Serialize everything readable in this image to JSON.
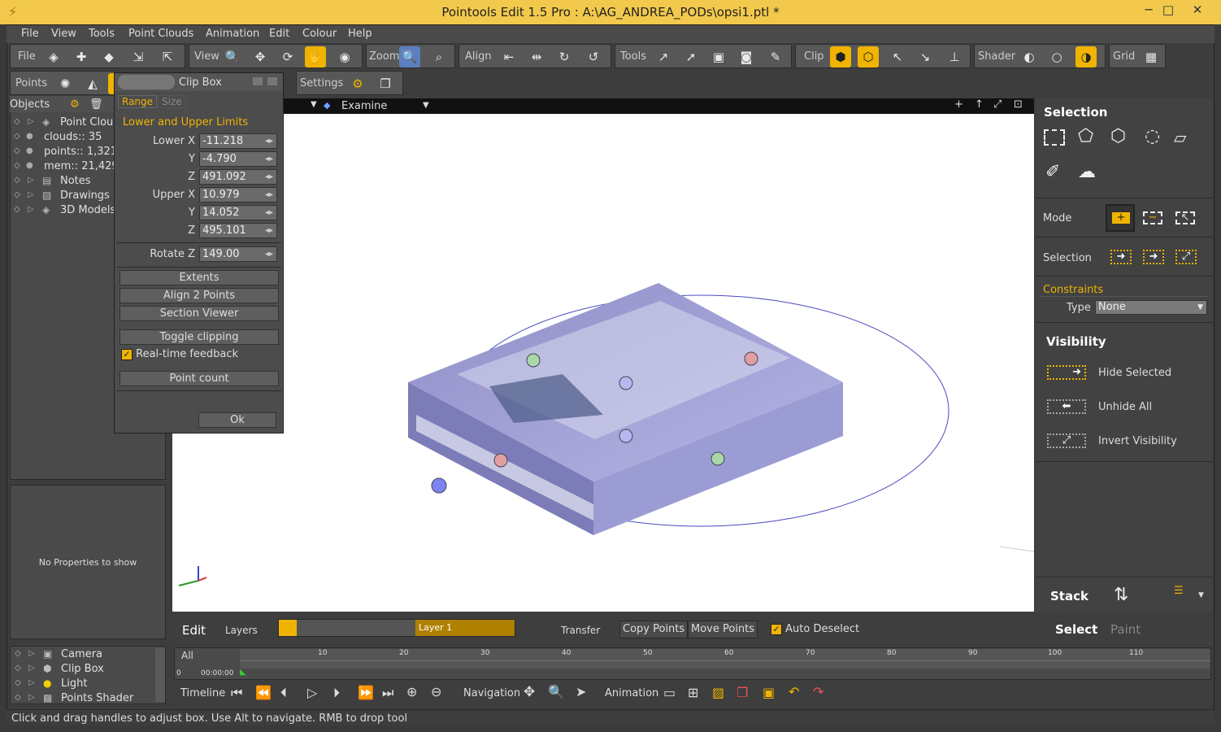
{
  "titlebar": {
    "title": "Pointools Edit 1.5 Pro  :  A:\\AG_ANDREA_PODs\\opsi1.ptl *",
    "min": "─",
    "max": "□",
    "close": "✕"
  },
  "menu": [
    "File",
    "View",
    "Tools",
    "Point Clouds",
    "Animation",
    "Edit",
    "Colour",
    "Help"
  ],
  "toolbar": {
    "file": "File",
    "view": "View",
    "zoom": "Zoom",
    "align": "Align",
    "tools": "Tools",
    "clip": "Clip",
    "shader": "Shader",
    "grid": "Grid",
    "points": "Points",
    "settings": "Settings"
  },
  "objects": {
    "header": "Objects",
    "tree": [
      {
        "label": "Point Clou"
      },
      {
        "label": "clouds:: 35"
      },
      {
        "label": "points:: 1,321"
      },
      {
        "label": "mem:: 21,429"
      },
      {
        "label": "Notes"
      },
      {
        "label": "Drawings"
      },
      {
        "label": "3D Models"
      }
    ]
  },
  "props": {
    "empty": "No Properties to show"
  },
  "layerlist": [
    {
      "label": "Camera"
    },
    {
      "label": "Clip Box"
    },
    {
      "label": "Light"
    },
    {
      "label": "Points Shader"
    }
  ],
  "clipbox": {
    "title": "Clip Box",
    "tab_range": "Range",
    "tab_size": "Size",
    "section": "Lower and Upper Limits",
    "lower_x_label": "Lower X",
    "lower_x": "-11.218",
    "lower_y_label": "Y",
    "lower_y": "-4.790",
    "lower_z_label": "Z",
    "lower_z": "491.092",
    "upper_x_label": "Upper X",
    "upper_x": "10.979",
    "upper_y_label": "Y",
    "upper_y": "14.052",
    "upper_z_label": "Z",
    "upper_z": "495.101",
    "rotate_label": "Rotate Z",
    "rotate": "149.00",
    "extents": "Extents",
    "align2": "Align 2 Points",
    "section_viewer": "Section Viewer",
    "toggle": "Toggle clipping",
    "realtime": "Real-time feedback",
    "point_count": "Point count",
    "ok": "Ok"
  },
  "viewport": {
    "mode": "Examine"
  },
  "right": {
    "selection_title": "Selection",
    "mode_label": "Mode",
    "selection_label": "Selection",
    "constraints": "Constraints",
    "type_label": "Type",
    "type_value": "None",
    "visibility_title": "Visibility",
    "hide": "Hide Selected",
    "unhide": "Unhide All",
    "invert": "Invert Visibility",
    "stack": "Stack"
  },
  "bottom": {
    "edit": "Edit",
    "layers": "Layers",
    "layer1": "Layer 1",
    "transfer": "Transfer",
    "copy": "Copy Points",
    "move": "Move Points",
    "auto": "Auto Deselect",
    "select": "Select",
    "paint": "Paint",
    "all": "All",
    "time": "00:00:00",
    "zero": "0",
    "ticks": [
      "10",
      "20",
      "30",
      "40",
      "50",
      "60",
      "70",
      "80",
      "90",
      "100",
      "110"
    ],
    "timeline": "Timeline",
    "navigation": "Navigation",
    "animation": "Animation"
  },
  "status": "Click and drag handles to adjust box. Use Alt to navigate. RMB to drop tool",
  "colors": {
    "accent": "#f0b400",
    "title_bg": "#f2c94c",
    "box": "#9b9fd8"
  }
}
